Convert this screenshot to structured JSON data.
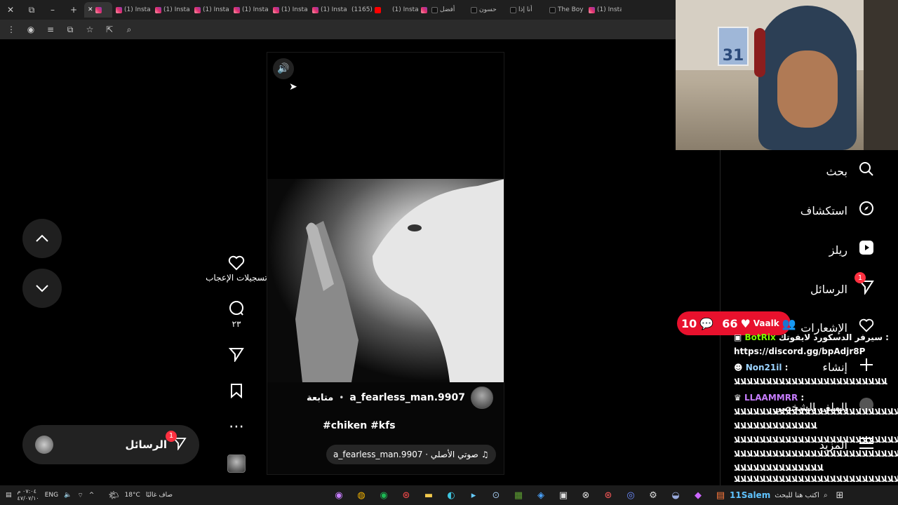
{
  "browser": {
    "window_controls": {
      "close": "✕",
      "restore": "⧉",
      "minimize": "–",
      "new_tab": "+"
    },
    "tabs": [
      {
        "label": "",
        "icon": "close-icon",
        "favicon": "instagram",
        "active": true
      },
      {
        "label": "(1) Insta",
        "favicon": "instagram"
      },
      {
        "label": "(1) Insta",
        "favicon": "instagram"
      },
      {
        "label": "(1) Insta",
        "favicon": "instagram"
      },
      {
        "label": "(1) Insta",
        "favicon": "instagram"
      },
      {
        "label": "(1) Insta",
        "favicon": "instagram"
      },
      {
        "label": "(1) Insta",
        "favicon": "instagram"
      },
      {
        "label": "(1165)",
        "favicon": "youtube"
      },
      {
        "label": "(1) Insta",
        "favicon": "instagram"
      },
      {
        "label": "أفضل",
        "favicon": "tiktok"
      },
      {
        "label": "حسون",
        "favicon": "tiktok"
      },
      {
        "label": "أنا إذا",
        "favicon": "tiktok"
      },
      {
        "label": "The Boy",
        "favicon": "tiktok"
      },
      {
        "label": "(1) Insta",
        "favicon": "instagram"
      }
    ]
  },
  "reel": {
    "author": "a_fearless_man.9907",
    "separator": "•",
    "follow_label": "متابعة",
    "caption": "#chiken #kfs",
    "audio": "a_fearless_man.9907 · صوتي الأصلي",
    "actions": {
      "likes_label": "تسجيلات الإعجاب",
      "comments_count": "٢٣"
    }
  },
  "messages_bar": {
    "label": "الرسائل",
    "badge": "1"
  },
  "sidebar": {
    "items": [
      {
        "label": "بحث",
        "icon": "search-icon"
      },
      {
        "label": "استكشاف",
        "icon": "explore-icon"
      },
      {
        "label": "ريلز",
        "icon": "reels-icon"
      },
      {
        "label": "الرسائل",
        "icon": "messages-icon",
        "badge": "1"
      },
      {
        "label": "الإشعارات",
        "icon": "heart-icon"
      },
      {
        "label": "إنشاء",
        "icon": "plus-icon"
      },
      {
        "label": "الملف الشخصي",
        "icon": "avatar-icon"
      },
      {
        "label": "المزيد",
        "icon": "menu-icon"
      }
    ]
  },
  "webcam": {
    "jersey_number": "31"
  },
  "stream": {
    "comments": "10",
    "likes": "66",
    "viewer_name": "Vaalk"
  },
  "chat": [
    {
      "user": "BotRix",
      "text": "سيرفر الدسكورد لايفوتك :"
    },
    {
      "user": "",
      "text": "https://discord.gg/bpAdjr8P"
    },
    {
      "user": "Non21il",
      "text": ":"
    },
    {
      "user": "",
      "text": "ﻼﻼﻼﻼﻼﻼﻼﻼﻼﻼﻼﻼﻼﻼﻼﻼﻼﻼﻼﻼﻼﻼﻼﻼ"
    },
    {
      "user": "LLAAMMRR",
      "text": ":"
    },
    {
      "user": "",
      "text": "ﻼﻼﻼﻼﻼﻼﻼﻼﻼﻼﻼﻼﻼﻼﻼﻼﻼﻼﻼﻼﻼﻼﻼﻼﻼﻼﻼﻼﻼﻼﻼﻼﻼﻼﻼ"
    },
    {
      "user": "",
      "text": "ﻼﻼﻼﻼﻼﻼﻼﻼﻼﻼﻼﻼﻼ"
    },
    {
      "user": "",
      "text": "ﻼﻼﻼﻼﻼﻼﻼﻼﻼﻼﻼﻼﻼﻼﻼﻼﻼﻼﻼﻼﻼﻼﻼﻼﻼﻼﻼﻼﻼﻼﻼﻼﻼﻼﻼ"
    },
    {
      "user": "",
      "text": "ﻼﻼﻼﻼﻼﻼﻼﻼﻼﻼﻼﻼﻼﻼﻼﻼﻼﻼﻼﻼﻼﻼﻼﻼﻼﻼﻼﻼﻼﻼﻼﻼﻼﻼﻼ"
    },
    {
      "user": "",
      "text": "ﻼﻼﻼﻼﻼﻼﻼﻼﻼﻼﻼﻼﻼﻼ"
    },
    {
      "user": "",
      "text": "ﻼﻼﻼﻼﻼﻼﻼﻼﻼﻼﻼﻼﻼﻼﻼﻼﻼﻼﻼﻼﻼﻼﻼﻼﻼﻼﻼﻼﻼﻼﻼﻼﻼﻼﻼ"
    },
    {
      "user": "",
      "text": "ﻼﻼﻼﻼﻼﻼﻼﻼﻼﻼﻼﻼﻼﻼ"
    }
  ],
  "taskbar": {
    "time": "٠٧:٠٤ م",
    "date": "٤٧/٠٧/١٠",
    "language": "ENG",
    "temperature": "18°C",
    "weather": "صاف غالبًا",
    "search_placeholder": "اكتب هنا للبحث",
    "tray_user": "11Salem"
  },
  "colors": {
    "live_red": "#e8112d",
    "badge_red": "#ff3040",
    "chat_green": "#7cfc00"
  }
}
